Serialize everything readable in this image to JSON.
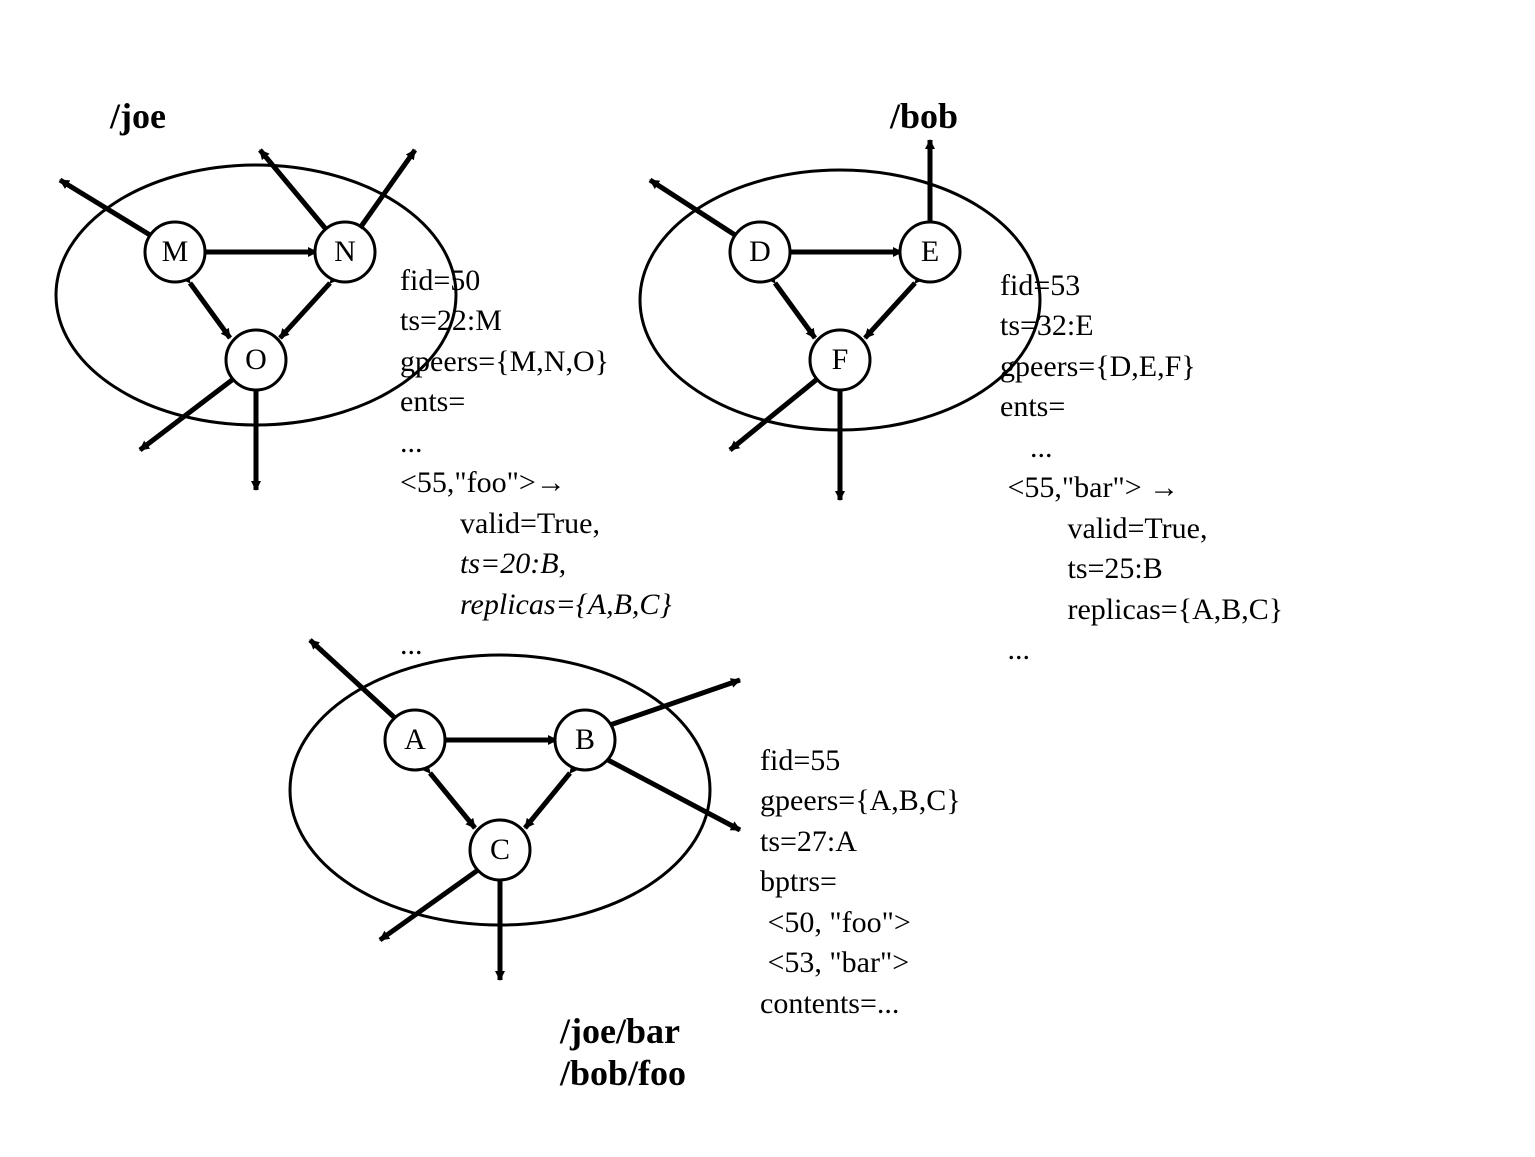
{
  "groups": {
    "joe": {
      "title": "/joe",
      "nodes": [
        "M",
        "N",
        "O"
      ],
      "info": {
        "fid": "fid=50",
        "ts": "ts=22:M",
        "gpeers": "gpeers={M,N,O}",
        "ents": "ents=",
        "dots1": "...",
        "entry": "<55,\"foo\">→",
        "valid": "valid=True,",
        "ts2": "ts=20:B,",
        "replicas": "replicas={A,B,C}",
        "dots2": "..."
      }
    },
    "bob": {
      "title": "/bob",
      "nodes": [
        "D",
        "E",
        "F"
      ],
      "info": {
        "fid": "fid=53",
        "ts": "ts=32:E",
        "gpeers": "gpeers={D,E,F}",
        "ents": "ents=",
        "dots1": "...",
        "entry": "<55,\"bar\"> →",
        "valid": "valid=True,",
        "ts2": "ts=25:B",
        "replicas": "replicas={A,B,C}",
        "dots2": "..."
      }
    },
    "abc": {
      "title": "/joe/bar\n/bob/foo",
      "nodes": [
        "A",
        "B",
        "C"
      ],
      "info": {
        "fid": "fid=55",
        "gpeers": "gpeers={A,B,C}",
        "ts": "ts=27:A",
        "bptrs": "bptrs=",
        "bp1": " <50, \"foo\">",
        "bp2": " <53, \"bar\">",
        "contents": "contents=..."
      }
    }
  }
}
